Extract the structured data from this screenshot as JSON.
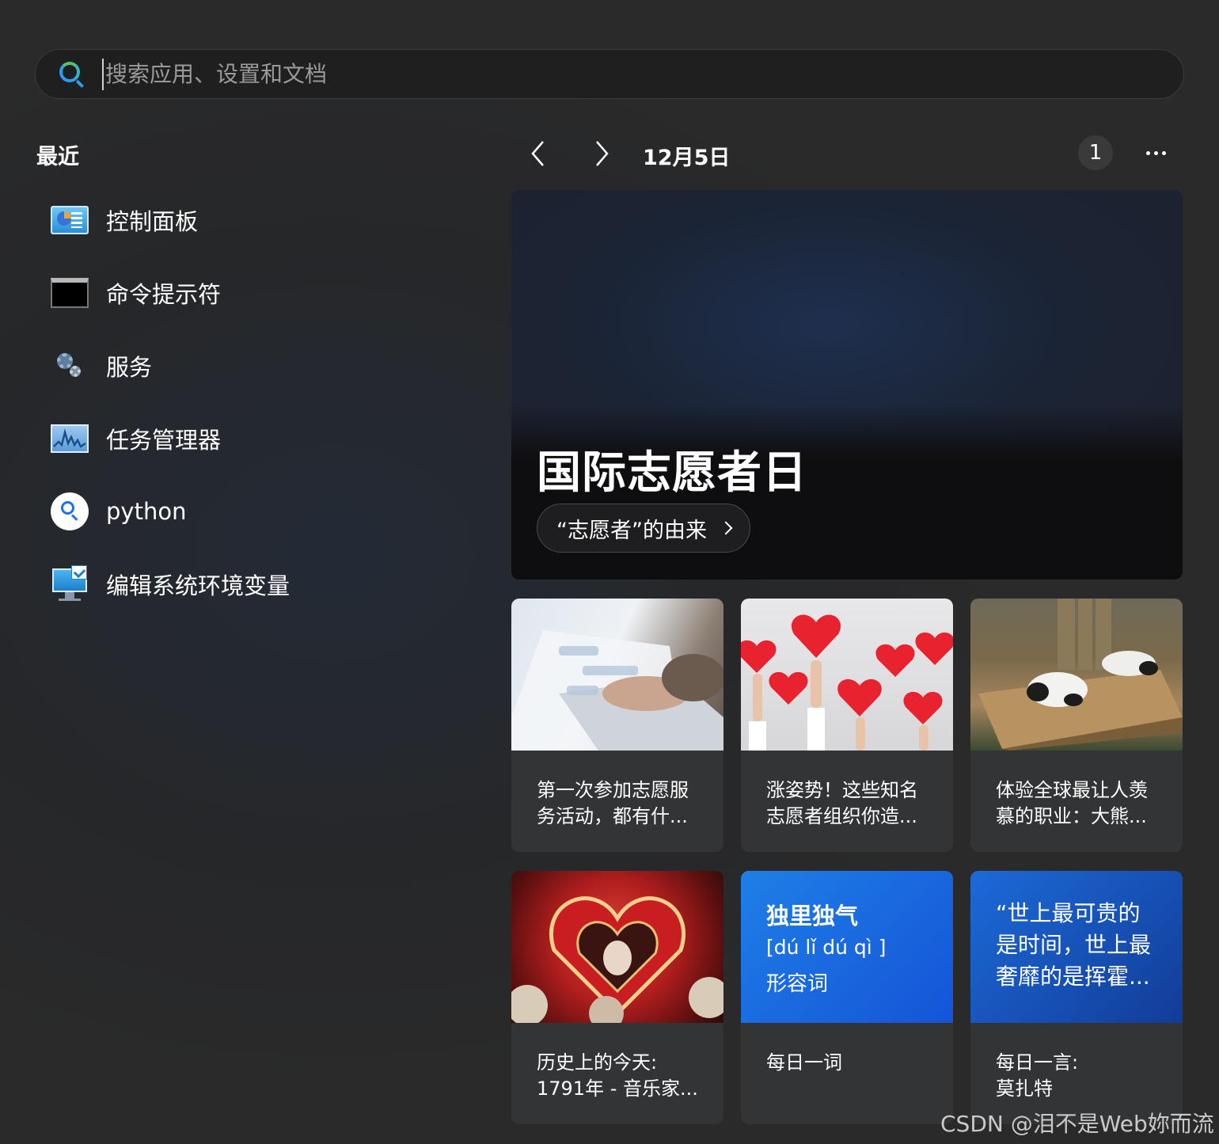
{
  "search": {
    "placeholder": "搜索应用、设置和文档",
    "value": ""
  },
  "recent": {
    "title": "最近",
    "items": [
      {
        "label": "控制面板",
        "icon": "control-panel-icon"
      },
      {
        "label": "命令提示符",
        "icon": "command-prompt-icon"
      },
      {
        "label": "服务",
        "icon": "services-gear-icon"
      },
      {
        "label": "任务管理器",
        "icon": "task-manager-icon"
      },
      {
        "label": "python",
        "icon": "search-icon"
      },
      {
        "label": "编辑系统环境变量",
        "icon": "system-properties-icon"
      }
    ]
  },
  "widgets": {
    "date": "12月5日",
    "badge_count": "1",
    "hero": {
      "title": "国际志愿者日",
      "link_label": "“志愿者”的由来"
    },
    "cards": [
      {
        "text": "第一次参加志愿服务活动，都有什..."
      },
      {
        "text": "涨姿势！这些知名志愿者组织你造..."
      },
      {
        "text": "体验全球最让人羡慕的职业：大熊..."
      },
      {
        "text_line1": "历史上的今天:",
        "text_line2": "1791年 - 音乐家..."
      },
      {
        "word": "独里独气",
        "pinyin": "[dú lǐ dú qì ]",
        "pos": "形容词",
        "text": "每日一词"
      },
      {
        "quote": "“世上最可贵的是时间，世上最奢靡的是挥霍...",
        "text_line1": "每日一言:",
        "text_line2": "莫扎特"
      }
    ]
  },
  "watermark": "CSDN @泪不是Web妳而流",
  "colors": {
    "accent": "#1a73e8",
    "word_card": "#1f7fe6",
    "quote_card": "#123c98"
  }
}
